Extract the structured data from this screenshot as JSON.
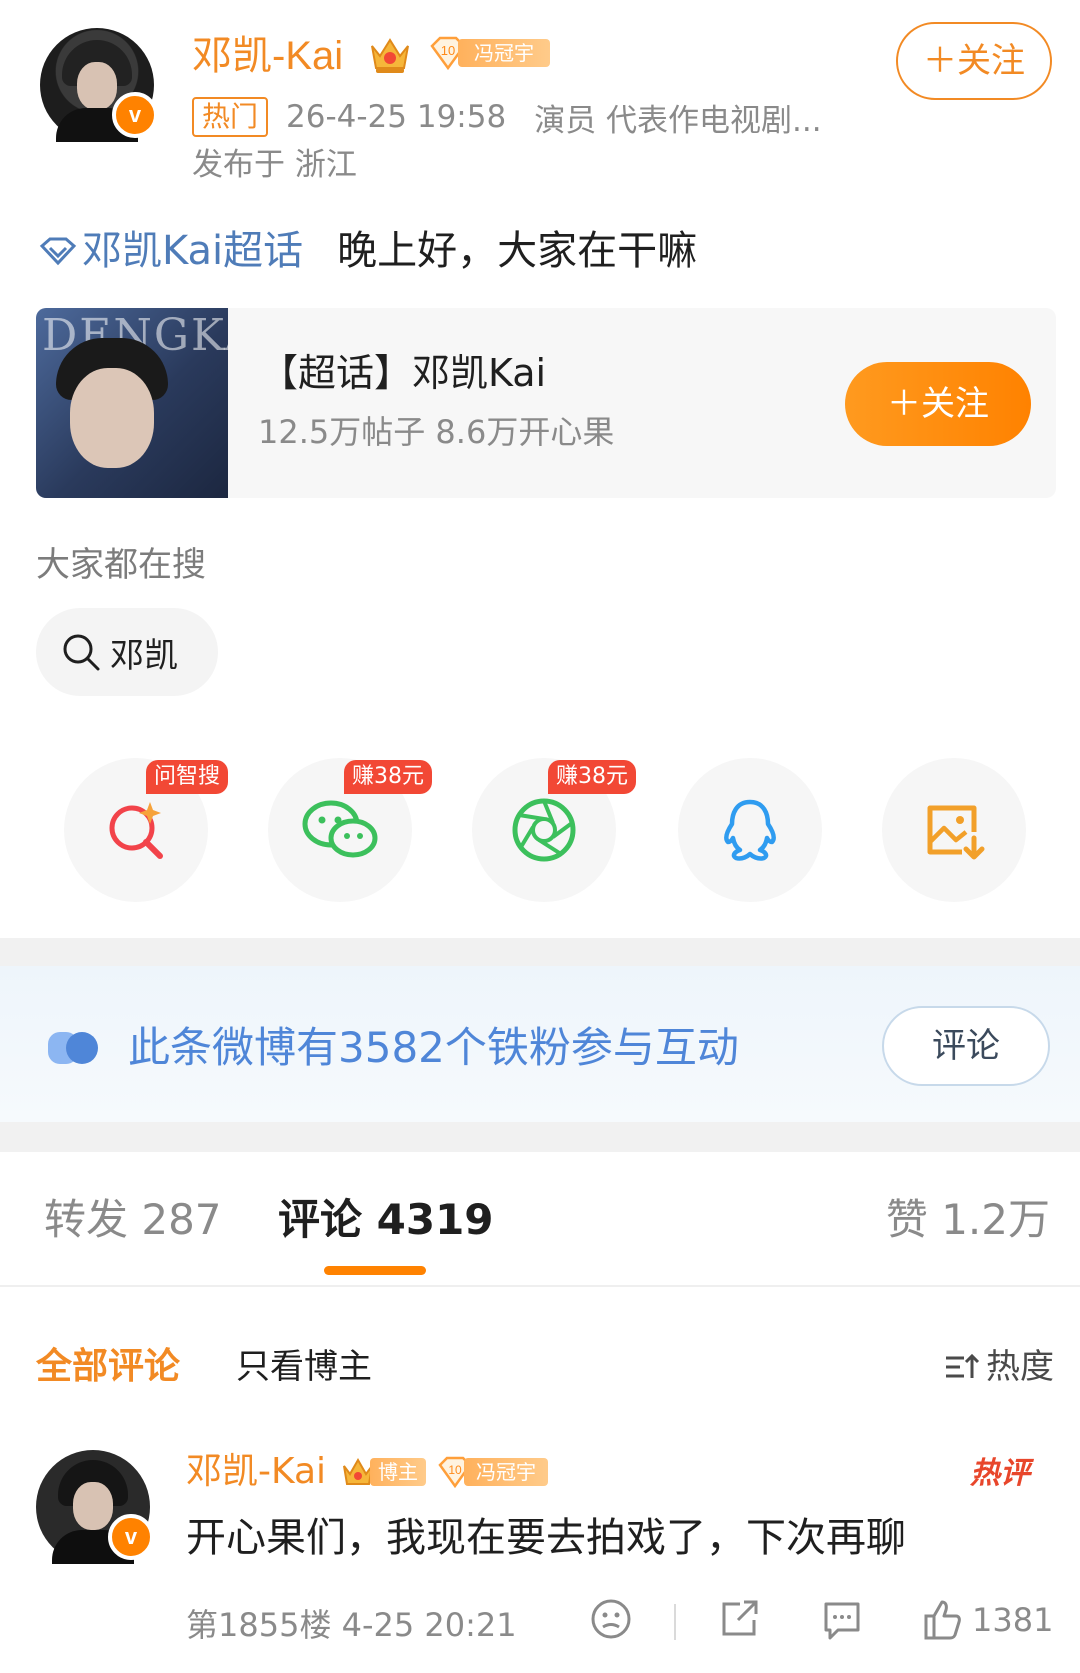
{
  "post": {
    "username": "邓凯-Kai",
    "fan_badge_level": "10",
    "fan_badge_name": "冯冠宇",
    "follow_label": "＋关注",
    "hot_tag": "热门",
    "time": "26-4-25 19:58",
    "bio": "演员 代表作电视剧...",
    "location": "发布于 浙江",
    "topic_link": "邓凯Kai超话",
    "text": "晚上好，大家在干嘛"
  },
  "topic_card": {
    "thumb_text": "DENGKAI",
    "name": "【超话】邓凯Kai",
    "stats": "12.5万帖子 8.6万开心果",
    "follow_label": "＋关注"
  },
  "search": {
    "label": "大家都在搜",
    "query": "邓凯"
  },
  "share": {
    "items": [
      {
        "icon": "ai-search-icon",
        "tag": "问智搜",
        "color": "#f2434a"
      },
      {
        "icon": "wechat-icon",
        "tag": "赚38元",
        "color": "#3cc05c"
      },
      {
        "icon": "moments-icon",
        "tag": "赚38元",
        "color": "#3cc05c"
      },
      {
        "icon": "qq-icon",
        "tag": "",
        "color": "#2f9cf0"
      },
      {
        "icon": "save-image-icon",
        "tag": "",
        "color": "#f2a02a"
      }
    ]
  },
  "fan_banner": {
    "text": "此条微博有3582个铁粉参与互动",
    "button": "评论"
  },
  "stats": {
    "repost": "转发 287",
    "comment": "评论 4319",
    "like": "赞 1.2万"
  },
  "filters": {
    "all": "全部评论",
    "author_only": "只看博主",
    "sort": "热度"
  },
  "comment": {
    "username": "邓凯-Kai",
    "author_badge": "博主",
    "fan_badge_level": "10",
    "fan_badge_name": "冯冠宇",
    "hot_tag": "热评",
    "text": "开心果们，我现在要去拍戏了，下次再聊",
    "floor": "第1855楼 4-25 20:21",
    "likes": "1381"
  },
  "colors": {
    "brand_orange": "#ff8200",
    "link_blue": "#4f7cb8",
    "banner_blue": "#4f86d8"
  }
}
